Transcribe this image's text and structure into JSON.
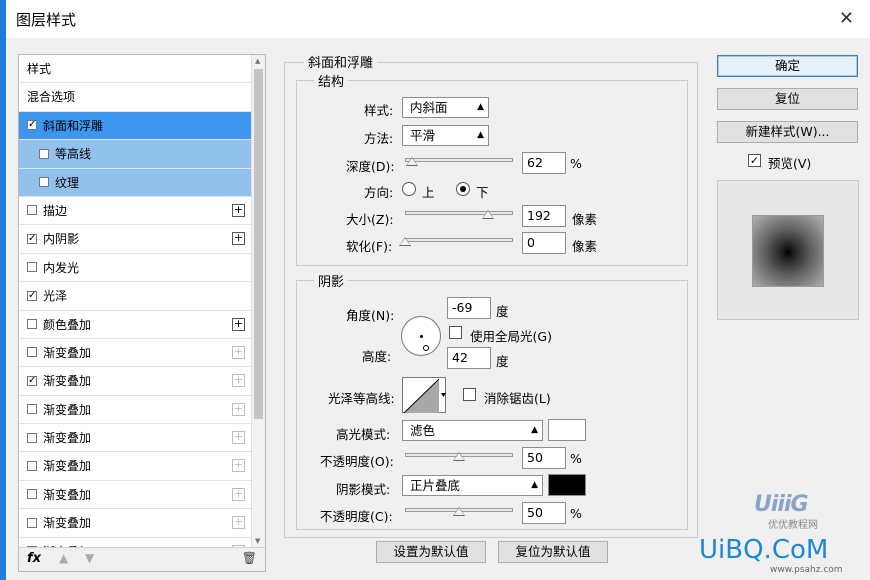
{
  "window": {
    "title": "图层样式"
  },
  "style_list": {
    "items": [
      {
        "label": "样式",
        "checked": null,
        "plus": null,
        "state": "header"
      },
      {
        "label": "混合选项",
        "checked": null,
        "plus": null,
        "state": "header"
      },
      {
        "label": "斜面和浮雕",
        "checked": true,
        "plus": null,
        "state": "selected"
      },
      {
        "label": "等高线",
        "checked": false,
        "plus": null,
        "state": "sub"
      },
      {
        "label": "纹理",
        "checked": false,
        "plus": null,
        "state": "sub"
      },
      {
        "label": "描边",
        "checked": false,
        "plus": "active",
        "state": "normal"
      },
      {
        "label": "内阴影",
        "checked": true,
        "plus": "active",
        "state": "normal"
      },
      {
        "label": "内发光",
        "checked": false,
        "plus": null,
        "state": "normal"
      },
      {
        "label": "光泽",
        "checked": true,
        "plus": null,
        "state": "normal"
      },
      {
        "label": "颜色叠加",
        "checked": false,
        "plus": "active",
        "state": "normal"
      },
      {
        "label": "渐变叠加",
        "checked": false,
        "plus": "dim",
        "state": "normal"
      },
      {
        "label": "渐变叠加",
        "checked": true,
        "plus": "dim",
        "state": "normal"
      },
      {
        "label": "渐变叠加",
        "checked": false,
        "plus": "dim",
        "state": "normal"
      },
      {
        "label": "渐变叠加",
        "checked": false,
        "plus": "dim",
        "state": "normal"
      },
      {
        "label": "渐变叠加",
        "checked": false,
        "plus": "dim",
        "state": "normal"
      },
      {
        "label": "渐变叠加",
        "checked": false,
        "plus": "dim",
        "state": "normal"
      },
      {
        "label": "渐变叠加",
        "checked": false,
        "plus": "dim",
        "state": "normal"
      },
      {
        "label": "渐变叠加",
        "checked": false,
        "plus": "dim",
        "state": "normal"
      }
    ],
    "footer": {
      "fx": "fx"
    }
  },
  "bevel": {
    "section_title": "斜面和浮雕",
    "structure_title": "结构",
    "style_label": "样式:",
    "style_value": "内斜面",
    "technique_label": "方法:",
    "technique_value": "平滑",
    "depth_label": "深度(D):",
    "depth_value": "62",
    "depth_unit": "%",
    "depth_fraction": 0.062,
    "direction_label": "方向:",
    "direction_up": "上",
    "direction_down": "下",
    "size_label": "大小(Z):",
    "size_value": "192",
    "size_unit": "像素",
    "size_fraction": 0.77,
    "soften_label": "软化(F):",
    "soften_value": "0",
    "soften_unit": "像素",
    "soften_fraction": 0.0
  },
  "shading": {
    "title": "阴影",
    "angle_label": "角度(N):",
    "angle_value": "-69",
    "angle_unit": "度",
    "global_light_label": "使用全局光(G)",
    "altitude_label": "高度:",
    "altitude_value": "42",
    "altitude_unit": "度",
    "gloss_contour_label": "光泽等高线:",
    "antialias_label": "消除锯齿(L)",
    "highlight_mode_label": "高光模式:",
    "highlight_mode_value": "滤色",
    "highlight_color": "#ffffff",
    "highlight_opacity_label": "不透明度(O):",
    "highlight_opacity_value": "50",
    "highlight_opacity_unit": "%",
    "shadow_mode_label": "阴影模式:",
    "shadow_mode_value": "正片叠底",
    "shadow_color": "#000000",
    "shadow_opacity_label": "不透明度(C):",
    "shadow_opacity_value": "50",
    "shadow_opacity_unit": "%",
    "opacity_fraction": 0.5
  },
  "bottom_buttons": {
    "set_default": "设置为默认值",
    "reset_default": "复位为默认值"
  },
  "right_panel": {
    "ok": "确定",
    "reset": "复位",
    "new_style": "新建样式(W)...",
    "preview_label": "预览(V)",
    "preview_checked": true
  },
  "watermark": {
    "logo": "UiBQ.CoM",
    "site_cn": "优优教程网",
    "site_url": "www.psahz.com"
  }
}
